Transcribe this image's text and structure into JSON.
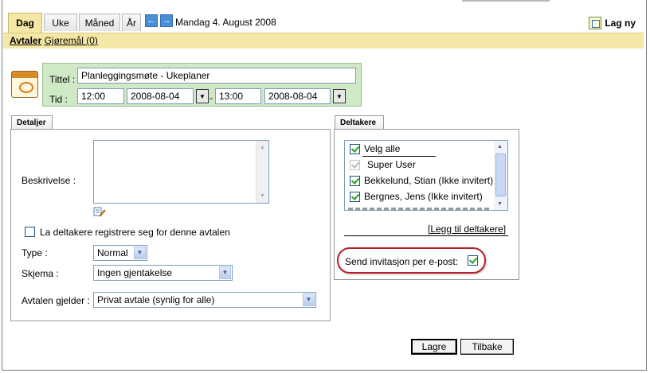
{
  "header": {
    "tabs": [
      {
        "label": "Dag",
        "active": true
      },
      {
        "label": "Uke",
        "active": false
      },
      {
        "label": "Måned",
        "active": false
      },
      {
        "label": "År",
        "active": false
      }
    ],
    "prev_icon": "arrow-left-icon",
    "next_icon": "arrow-right-icon",
    "date": "Mandag 4. August 2008",
    "new_label": "Lag ny",
    "new_icon": "new-appointment-icon"
  },
  "subnav": {
    "appointments": "Avtaler",
    "tasks": "Gjøremål (0)"
  },
  "form": {
    "title_label": "Tittel :",
    "title_value": "Planleggingsmøte - Ukeplaner",
    "time_label": "Tid :",
    "start_time": "12:00",
    "start_date": "2008-08-04",
    "separator": "-",
    "end_time": "13:00",
    "end_date": "2008-08-04",
    "calendar_icon": "calendar-icon"
  },
  "details": {
    "tab_label": "Detaljer",
    "description_label": "Beskrivelse :",
    "description_value": "",
    "edit_icon": "edit-description-icon",
    "register_label": "La deltakere registrere seg for denne avtalen",
    "register_checked": false,
    "type_label": "Type :",
    "type_value": "Normal",
    "schema_label": "Skjema :",
    "schema_value": "Ingen gjentakelse",
    "applies_label": "Avtalen gjelder :",
    "applies_value": "Privat avtale (synlig for alle)"
  },
  "participants": {
    "tab_label": "Deltakere",
    "select_all": "Velg alle",
    "items": [
      {
        "name": "Super User",
        "checked": true,
        "disabled": true
      },
      {
        "name": "Bekkelund, Stian (Ikke invitert)",
        "checked": true,
        "disabled": false
      },
      {
        "name": "Bergnes, Jens (Ikke invitert)",
        "checked": true,
        "disabled": false
      }
    ],
    "add_link": "[Legg til deltakere]",
    "send_label": "Send invitasjon per e-post:",
    "send_checked": true
  },
  "actions": {
    "save": "Lagre",
    "back": "Tilbake"
  },
  "colors": {
    "tab_active_bg": "#f5e8a6",
    "title_box_bg": "#cfe8c5",
    "highlight": "#b3202a",
    "nav_button": "#4a8fd6"
  }
}
